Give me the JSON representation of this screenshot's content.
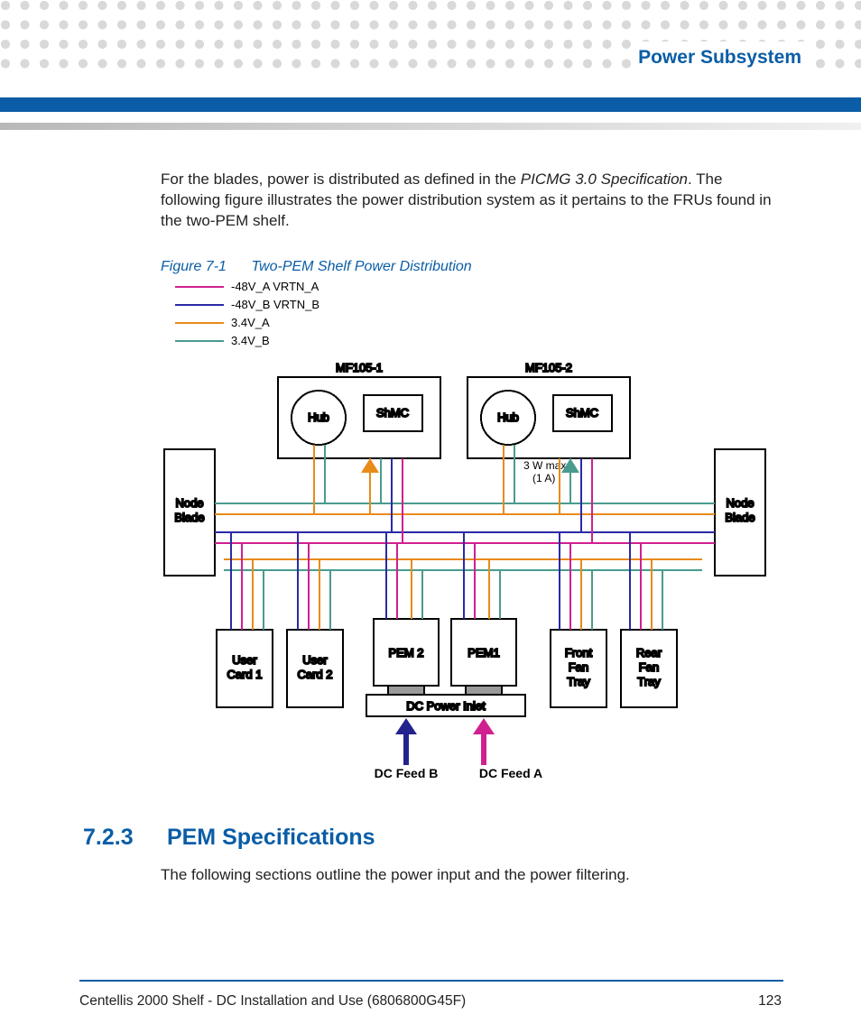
{
  "header": {
    "title": "Power Subsystem"
  },
  "intro": {
    "p1_a": "For the blades, power is distributed as defined in the ",
    "p1_i": "PICMG 3.0 Specification",
    "p1_b": ". The following figure illustrates the power distribution system as it pertains to the FRUs found in the two-PEM shelf."
  },
  "figure": {
    "num": "Figure 7-1",
    "title": "Two-PEM Shelf Power Distribution",
    "legend": [
      {
        "label": "-48V_A VRTN_A",
        "color": "#d02090"
      },
      {
        "label": "-48V_B VRTN_B",
        "color": "#2a2aa6"
      },
      {
        "label": "3.4V_A",
        "color": "#e88b1a"
      },
      {
        "label": "3.4V_B",
        "color": "#4a9b8f"
      }
    ],
    "blocks": {
      "mf1": "MF105-1",
      "mf2": "MF105-2",
      "hub": "Hub",
      "shmc": "ShMC",
      "node_l": "Node\nBlade",
      "node_r": "Node\nBlade",
      "user1": "User\nCard 1",
      "user2": "User\nCard 2",
      "pem1": "PEM1",
      "pem2": "PEM 2",
      "ffan": "Front\nFan\nTray",
      "rfan": "Rear\nFan\nTray",
      "dc_inlet": "DC Power Inlet",
      "feed_a": "DC Feed A",
      "feed_b": "DC Feed B",
      "note": "3 W max\n(1 A)"
    }
  },
  "section": {
    "num": "7.2.3",
    "title": "PEM Specifications",
    "body": "The following sections outline the power input and the power filtering."
  },
  "footer": {
    "left": "Centellis 2000 Shelf - DC Installation and Use (6806800G45F)",
    "page": "123"
  }
}
